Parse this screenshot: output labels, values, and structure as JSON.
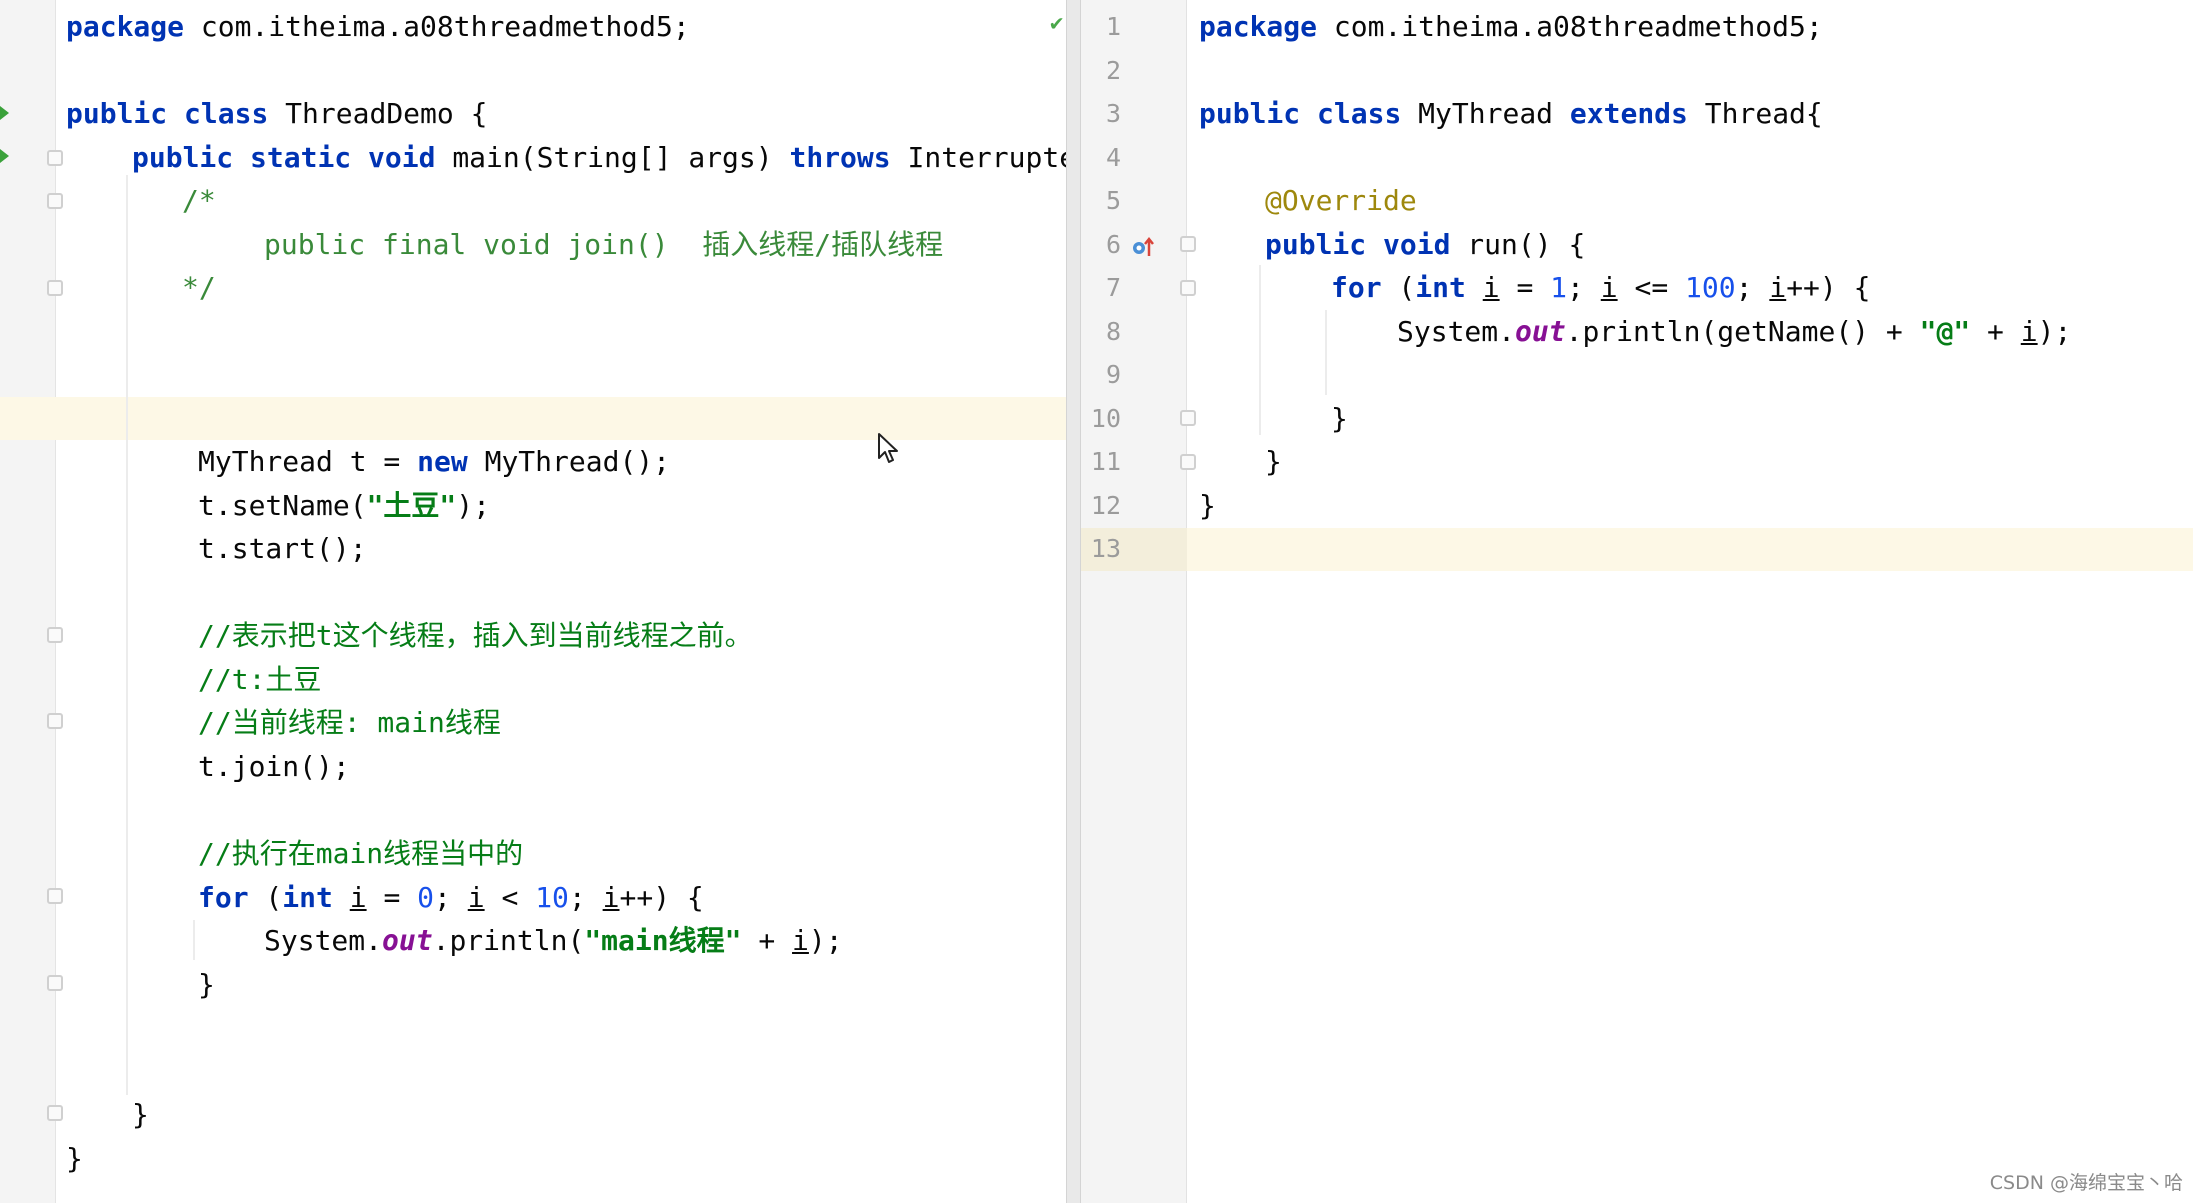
{
  "left_editor": {
    "lines": {
      "l1": [
        "package",
        " com.itheima.a08threadmethod5;"
      ],
      "l3": [
        "public",
        " ",
        "class",
        " ThreadDemo {"
      ],
      "l4": [
        "public",
        " ",
        "static",
        " ",
        "void",
        " main(String[] args) ",
        "throws",
        " InterruptedE"
      ],
      "l5": "/*",
      "l6": "public final void join()  插入线程/插队线程",
      "l7": "*/",
      "l11": [
        "MyThread t = ",
        "new",
        " MyThread();"
      ],
      "l12": [
        "t.setName(",
        "\"土豆\"",
        ");"
      ],
      "l13": "t.start();",
      "l15": "//表示把t这个线程，插入到当前线程之前。",
      "l16": "//t:土豆",
      "l17": "//当前线程: main线程",
      "l18": "t.join();",
      "l20": "//执行在main线程当中的",
      "l21": [
        "for",
        " (",
        "int",
        " ",
        "i",
        " = ",
        "0",
        "; ",
        "i",
        " < ",
        "10",
        "; ",
        "i",
        "++) {"
      ],
      "l22": [
        "System.",
        "out",
        ".println(",
        "\"main线程\"",
        " + ",
        "i",
        ");"
      ],
      "l23": "}",
      "l26": "}",
      "l27": "}"
    }
  },
  "right_editor": {
    "line_numbers": [
      "1",
      "2",
      "3",
      "4",
      "5",
      "6",
      "7",
      "8",
      "9",
      "10",
      "11",
      "12",
      "13"
    ],
    "lines": {
      "l1": [
        "package",
        " com.itheima.a08threadmethod5;"
      ],
      "l3": [
        "public",
        " ",
        "class",
        " MyThread ",
        "extends",
        " Thread{"
      ],
      "l5": "@Override",
      "l6": [
        "public",
        " ",
        "void",
        " run() {"
      ],
      "l7": [
        "for",
        " (",
        "int",
        " ",
        "i",
        " = ",
        "1",
        "; ",
        "i",
        " <= ",
        "100",
        "; ",
        "i",
        "++) {"
      ],
      "l8": [
        "System.",
        "out",
        ".println(getName() + ",
        "\"@\"",
        " + ",
        "i",
        ");"
      ],
      "l10": "}",
      "l11": "}",
      "l12": "}"
    }
  },
  "watermark": "CSDN @海绵宝宝丶哈",
  "colors": {
    "keyword": "#0033b3",
    "string": "#067d17",
    "number": "#1750eb",
    "annotation": "#9e880d",
    "static_field": "#871094",
    "current_line": "#fdf8e6"
  }
}
